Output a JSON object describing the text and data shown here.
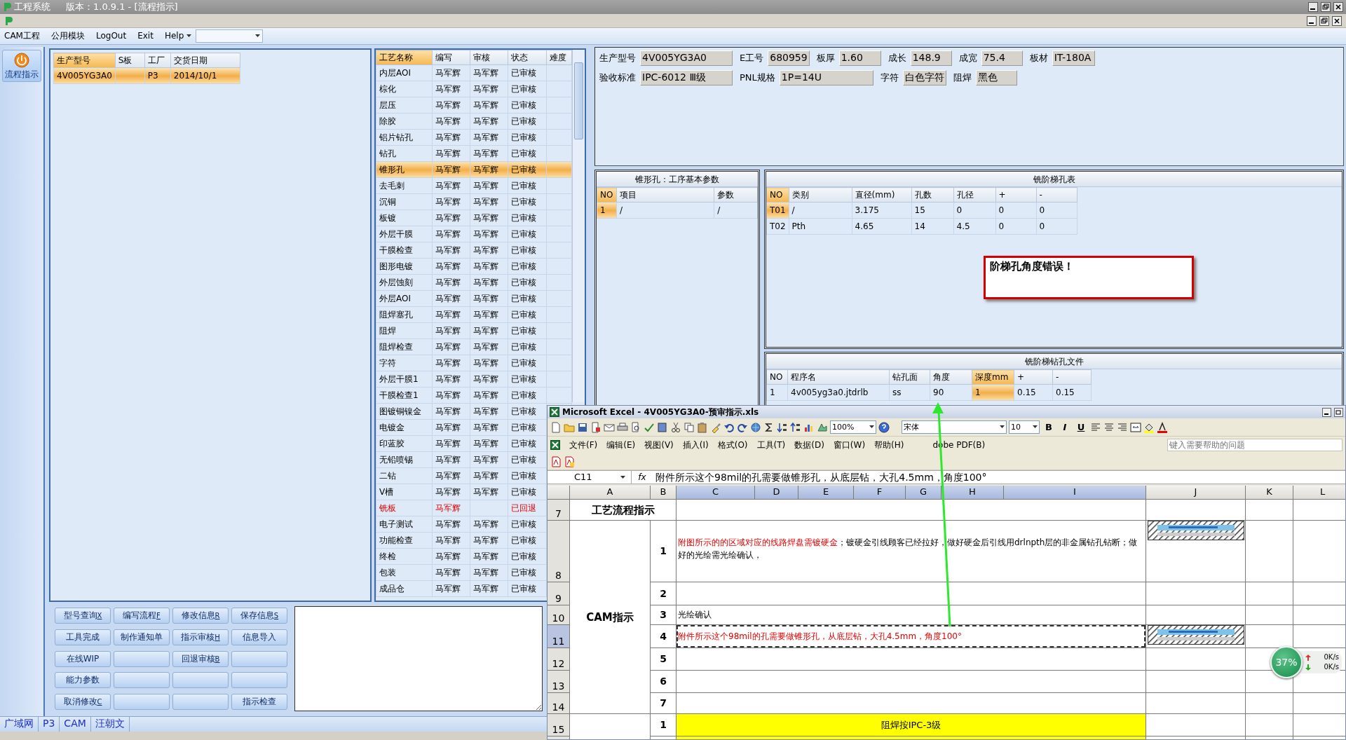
{
  "window": {
    "title": "工程系统",
    "caption": "版本：1.0.9.1 - [流程指示]"
  },
  "menu": [
    {
      "label": "CAM工程",
      "kind": "plain"
    },
    {
      "label": "公用模块",
      "kind": "plain"
    },
    {
      "label": "LogOut",
      "kind": "plain"
    },
    {
      "label": "Exit",
      "kind": "plain"
    },
    {
      "label": "Help",
      "kind": "dropdown"
    }
  ],
  "nav": [
    {
      "label": "流程指示",
      "selected": true
    }
  ],
  "orders": {
    "columns": [
      {
        "label": "生产型号",
        "selected": true
      },
      {
        "label": "S板",
        "selected": false
      },
      {
        "label": "工厂",
        "selected": false
      },
      {
        "label": "交货日期",
        "selected": false
      }
    ],
    "rows": [
      {
        "model": "4V005YG3A0",
        "factory": "P3",
        "date": "2014/10/1",
        "selected": true
      }
    ]
  },
  "processes": {
    "columns": [
      {
        "label": "工艺名称",
        "selected": true
      },
      {
        "label": "编写",
        "selected": false
      },
      {
        "label": "审核",
        "selected": false
      },
      {
        "label": "状态",
        "selected": false
      },
      {
        "label": "难度",
        "selected": false
      }
    ],
    "rows": [
      {
        "name": "内层AOI",
        "writer": "马军辉",
        "reviewer": "马军辉",
        "status": "已审核",
        "kind": "normal",
        "selected": false
      },
      {
        "name": "棕化",
        "writer": "马军辉",
        "reviewer": "马军辉",
        "status": "已审核",
        "kind": "normal",
        "selected": false
      },
      {
        "name": "层压",
        "writer": "马军辉",
        "reviewer": "马军辉",
        "status": "已审核",
        "kind": "normal",
        "selected": false
      },
      {
        "name": "除胶",
        "writer": "马军辉",
        "reviewer": "马军辉",
        "status": "已审核",
        "kind": "normal",
        "selected": false
      },
      {
        "name": "铝片钻孔",
        "writer": "马军辉",
        "reviewer": "马军辉",
        "status": "已审核",
        "kind": "normal",
        "selected": false
      },
      {
        "name": "钻孔",
        "writer": "马军辉",
        "reviewer": "马军辉",
        "status": "已审核",
        "kind": "normal",
        "selected": false
      },
      {
        "name": "锥形孔",
        "writer": "马军辉",
        "reviewer": "马军辉",
        "status": "已审核",
        "kind": "normal",
        "selected": true
      },
      {
        "name": "去毛刺",
        "writer": "马军辉",
        "reviewer": "马军辉",
        "status": "已审核",
        "kind": "normal",
        "selected": false
      },
      {
        "name": "沉铜",
        "writer": "马军辉",
        "reviewer": "马军辉",
        "status": "已审核",
        "kind": "normal",
        "selected": false
      },
      {
        "name": "板镀",
        "writer": "马军辉",
        "reviewer": "马军辉",
        "status": "已审核",
        "kind": "normal",
        "selected": false
      },
      {
        "name": "外层干膜",
        "writer": "马军辉",
        "reviewer": "马军辉",
        "status": "已审核",
        "kind": "normal",
        "selected": false
      },
      {
        "name": "干膜检查",
        "writer": "马军辉",
        "reviewer": "马军辉",
        "status": "已审核",
        "kind": "normal",
        "selected": false
      },
      {
        "name": "图形电镀",
        "writer": "马军辉",
        "reviewer": "马军辉",
        "status": "已审核",
        "kind": "normal",
        "selected": false
      },
      {
        "name": "外层蚀刻",
        "writer": "马军辉",
        "reviewer": "马军辉",
        "status": "已审核",
        "kind": "normal",
        "selected": false
      },
      {
        "name": "外层AOI",
        "writer": "马军辉",
        "reviewer": "马军辉",
        "status": "已审核",
        "kind": "normal",
        "selected": false
      },
      {
        "name": "阻焊塞孔",
        "writer": "马军辉",
        "reviewer": "马军辉",
        "status": "已审核",
        "kind": "normal",
        "selected": false
      },
      {
        "name": "阻焊",
        "writer": "马军辉",
        "reviewer": "马军辉",
        "status": "已审核",
        "kind": "normal",
        "selected": false
      },
      {
        "name": "阻焊检查",
        "writer": "马军辉",
        "reviewer": "马军辉",
        "status": "已审核",
        "kind": "normal",
        "selected": false
      },
      {
        "name": "字符",
        "writer": "马军辉",
        "reviewer": "马军辉",
        "status": "已审核",
        "kind": "normal",
        "selected": false
      },
      {
        "name": "外层干膜1",
        "writer": "马军辉",
        "reviewer": "马军辉",
        "status": "已审核",
        "kind": "normal",
        "selected": false
      },
      {
        "name": "干膜检查1",
        "writer": "马军辉",
        "reviewer": "马军辉",
        "status": "已审核",
        "kind": "normal",
        "selected": false
      },
      {
        "name": "图镀铜镍金",
        "writer": "马军辉",
        "reviewer": "马军辉",
        "status": "已审核",
        "kind": "normal",
        "selected": false
      },
      {
        "name": "电镀金",
        "writer": "马军辉",
        "reviewer": "马军辉",
        "status": "已审核",
        "kind": "normal",
        "selected": false
      },
      {
        "name": "印蓝胶",
        "writer": "马军辉",
        "reviewer": "马军辉",
        "status": "已审核",
        "kind": "normal",
        "selected": false
      },
      {
        "name": "无铅喷锡",
        "writer": "马军辉",
        "reviewer": "马军辉",
        "status": "已审核",
        "kind": "normal",
        "selected": false
      },
      {
        "name": "二钻",
        "writer": "马军辉",
        "reviewer": "马军辉",
        "status": "已审核",
        "kind": "normal",
        "selected": false
      },
      {
        "name": "V槽",
        "writer": "马军辉",
        "reviewer": "马军辉",
        "status": "已审核",
        "kind": "normal",
        "selected": false
      },
      {
        "name": "铣板",
        "writer": "马军辉",
        "status": "已回退",
        "kind": "returned",
        "selected": false
      },
      {
        "name": "电子测试",
        "writer": "马军辉",
        "reviewer": "马军辉",
        "status": "已审核",
        "kind": "normal",
        "selected": false
      },
      {
        "name": "功能检查",
        "writer": "马军辉",
        "reviewer": "马军辉",
        "status": "已审核",
        "kind": "normal",
        "selected": false
      },
      {
        "name": "终检",
        "writer": "马军辉",
        "reviewer": "马军辉",
        "status": "已审核",
        "kind": "normal",
        "selected": false
      },
      {
        "name": "包装",
        "writer": "马军辉",
        "reviewer": "马军辉",
        "status": "已审核",
        "kind": "normal",
        "selected": false
      },
      {
        "name": "成品仓",
        "writer": "马军辉",
        "reviewer": "马军辉",
        "status": "已审核",
        "kind": "normal",
        "selected": false
      }
    ]
  },
  "buttons": [
    {
      "kind": "labeled",
      "label": "型号查询",
      "accel": "X"
    },
    {
      "kind": "labeled",
      "label": "编写流程",
      "accel": "F"
    },
    {
      "kind": "labeled",
      "label": "修改信息",
      "accel": "R"
    },
    {
      "kind": "labeled",
      "label": "保存信息",
      "accel": "S"
    },
    {
      "kind": "labeled",
      "label": "工具完成"
    },
    {
      "kind": "labeled",
      "label": "制作通知单"
    },
    {
      "kind": "labeled",
      "label": "指示审核",
      "accel": "H"
    },
    {
      "kind": "labeled",
      "label": "信息导入"
    },
    {
      "kind": "labeled",
      "label": "在线WIP"
    },
    {
      "kind": "blank"
    },
    {
      "kind": "labeled",
      "label": "回退审核",
      "accel": "B"
    },
    {
      "kind": "blank"
    },
    {
      "kind": "labeled",
      "label": "能力参数"
    },
    {
      "kind": "blank"
    },
    {
      "kind": "blank"
    },
    {
      "kind": "blank"
    },
    {
      "kind": "labeled",
      "label": "取消修改",
      "accel": "C"
    },
    {
      "kind": "blank"
    },
    {
      "kind": "blank"
    },
    {
      "kind": "labeled",
      "label": "指示检查"
    }
  ],
  "header_form": [
    [
      {
        "label": "生产型号",
        "value": "4V005YG3A0"
      },
      {
        "label": "E工号",
        "value": "680959"
      },
      {
        "label": "板厚",
        "value": "1.60"
      },
      {
        "label": "成长",
        "value": "148.9"
      },
      {
        "label": "成宽",
        "value": "75.4"
      },
      {
        "label": "板材",
        "value": "IT-180A"
      }
    ],
    [
      {
        "label": "验收标准",
        "value": "IPC-6012 Ⅲ级"
      },
      {
        "label": "PNL规格",
        "value": "1P=14U"
      },
      {
        "label": "字符",
        "value": "白色字符"
      },
      {
        "label": "阻焊",
        "value": "黑色"
      }
    ]
  ],
  "cone_panel": {
    "title": "锥形孔：工序基本参数",
    "columns": [
      {
        "label": "NO",
        "selected": true
      },
      {
        "label": "项目",
        "selected": false
      },
      {
        "label": "参数",
        "selected": false
      }
    ],
    "rows": [
      {
        "cells": [
          "1",
          "/",
          "/"
        ],
        "selected": true
      }
    ]
  },
  "step_table": {
    "title": "铣阶梯孔表",
    "columns": [
      {
        "label": "NO",
        "selected": true
      },
      {
        "label": "类别",
        "selected": false
      },
      {
        "label": "直径(mm)",
        "selected": false
      },
      {
        "label": "孔数",
        "selected": false
      },
      {
        "label": "孔径",
        "selected": false
      },
      {
        "label": "+",
        "selected": false
      },
      {
        "label": "-",
        "selected": false
      }
    ],
    "rows": [
      {
        "cells": [
          "T01",
          "/",
          "3.175",
          "15",
          "0",
          "0",
          "0"
        ],
        "selected": true
      },
      {
        "cells": [
          "T02",
          "Pth",
          "4.65",
          "14",
          "4.5",
          "0",
          "0"
        ],
        "selected": false
      }
    ]
  },
  "message": "阶梯孔角度错误！",
  "drill_files": {
    "title": "铣阶梯钻孔文件",
    "columns": [
      {
        "label": "NO",
        "selected": false
      },
      {
        "label": "程序名",
        "selected": false
      },
      {
        "label": "钻孔面",
        "selected": false
      },
      {
        "label": "角度",
        "selected": false
      },
      {
        "label": "深度mm",
        "selected": true
      },
      {
        "label": "+",
        "selected": false
      },
      {
        "label": "-",
        "selected": false
      }
    ],
    "rows": [
      {
        "cells": [
          "1",
          "4v005yg3a0.jtdrlb",
          "ss",
          "90",
          "1",
          "0.15",
          "0.15"
        ],
        "selected": true
      }
    ]
  },
  "excel": {
    "title": "Microsoft Excel - 4V005YG3A0-预审指示.xls",
    "zoom": "100%",
    "font": "宋体",
    "font_size": "10",
    "format_buttons": [
      "B",
      "I",
      "U"
    ],
    "menu": [
      "文件(F)",
      "编辑(E)",
      "视图(V)",
      "插入(I)",
      "格式(O)",
      "工具(T)",
      "数据(D)",
      "窗口(W)",
      "帮助(H)",
      "dobe PDF(B)"
    ],
    "help_placeholder": "键入需要帮助的问题",
    "name_box": "C11",
    "fx": "fx",
    "formula": "附件所示这个98mil的孔需要做锥形孔，从底层钻，大孔4.5mm，角度100°",
    "columns": [
      {
        "label": "A",
        "selected": false
      },
      {
        "label": "B",
        "selected": false
      },
      {
        "label": "C",
        "selected": true
      },
      {
        "label": "D",
        "selected": true
      },
      {
        "label": "E",
        "selected": true
      },
      {
        "label": "F",
        "selected": true
      },
      {
        "label": "G",
        "selected": true
      },
      {
        "label": "H",
        "selected": true
      },
      {
        "label": "I",
        "selected": true
      },
      {
        "label": "J",
        "selected": false
      },
      {
        "label": "K",
        "selected": false
      },
      {
        "label": "L",
        "selected": false
      }
    ],
    "row_numbers": [
      {
        "label": "7",
        "selected": false
      },
      {
        "label": "8",
        "selected": false
      },
      {
        "label": "9",
        "selected": false
      },
      {
        "label": "10",
        "selected": false
      },
      {
        "label": "11",
        "selected": true
      },
      {
        "label": "12",
        "selected": false
      },
      {
        "label": "13",
        "selected": false
      },
      {
        "label": "14",
        "selected": false
      },
      {
        "label": "15",
        "selected": false
      }
    ],
    "title_cell": "工艺流程指示",
    "section": "CAM指示",
    "items": [
      {
        "no": "1",
        "parts": [
          {
            "text": "附图所示的的区域对应的线路焊盘需镀硬金",
            "kind": "warning"
          },
          {
            "text": "；镀硬金引线顾客已经拉好，做好硬金后引线用drlnpth层的非金属钻孔钻断；做好的光绘需光绘确认，",
            "kind": "normal"
          }
        ],
        "has_picture": true,
        "copied": false
      },
      {
        "no": "2",
        "has_picture": false,
        "copied": false
      },
      {
        "no": "3",
        "parts": [
          {
            "text": "光绘确认",
            "kind": "normal"
          }
        ],
        "has_picture": false,
        "copied": false
      },
      {
        "no": "4",
        "parts": [
          {
            "text": "附件所示这个98mil的孔需要做锥形孔，从底层钻，大孔4.5mm，角度100°",
            "kind": "warning"
          }
        ],
        "has_picture": true,
        "copied": true
      },
      {
        "no": "5",
        "has_picture": false,
        "copied": false
      },
      {
        "no": "6",
        "has_picture": false,
        "copied": false
      },
      {
        "no": "7",
        "has_picture": false,
        "copied": false
      }
    ],
    "section2": [
      {
        "no": "1",
        "text": "阻焊按IPC-3级"
      }
    ]
  },
  "network_meter": {
    "percent": "37%",
    "up": "0K/s",
    "down": "0K/s"
  },
  "status_bar": [
    "广域网",
    "P3",
    "CAM",
    "汪朝文"
  ]
}
